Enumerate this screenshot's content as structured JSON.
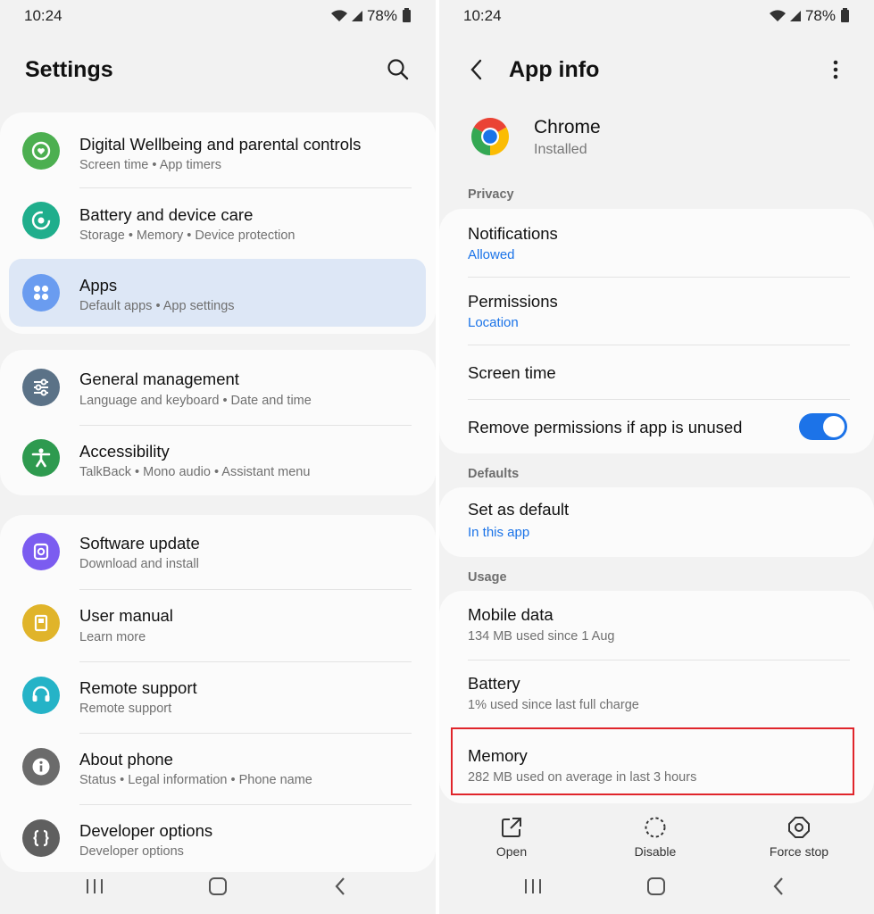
{
  "status_bar": {
    "time": "10:24",
    "battery": "78%"
  },
  "settings": {
    "title": "Settings",
    "groups": [
      {
        "items": [
          {
            "title": "Digital Wellbeing and parental controls",
            "subtitle": "Screen time  •  App timers",
            "icon": "digital-wellbeing-icon",
            "color": "#4caf50"
          },
          {
            "title": "Battery and device care",
            "subtitle": "Storage  •  Memory  •  Device protection",
            "icon": "device-care-icon",
            "color": "#1fae8c"
          },
          {
            "title": "Apps",
            "subtitle": "Default apps  •  App settings",
            "icon": "apps-icon",
            "color": "#6a9cf0"
          }
        ]
      },
      {
        "items": [
          {
            "title": "General management",
            "subtitle": "Language and keyboard  •  Date and time",
            "icon": "sliders-icon",
            "color": "#5b7287"
          },
          {
            "title": "Accessibility",
            "subtitle": "TalkBack  •  Mono audio  •  Assistant menu",
            "icon": "accessibility-icon",
            "color": "#2e9a4f"
          }
        ]
      },
      {
        "items": [
          {
            "title": "Software update",
            "subtitle": "Download and install",
            "icon": "software-update-icon",
            "color": "#7b5cf0"
          },
          {
            "title": "User manual",
            "subtitle": "Learn more",
            "icon": "manual-icon",
            "color": "#e0b42a"
          },
          {
            "title": "Remote support",
            "subtitle": "Remote support",
            "icon": "headset-icon",
            "color": "#25b3c7"
          },
          {
            "title": "About phone",
            "subtitle": "Status  •  Legal information  •  Phone name",
            "icon": "info-icon",
            "color": "#6b6b6b"
          },
          {
            "title": "Developer options",
            "subtitle": "Developer options",
            "icon": "braces-icon",
            "color": "#5f5f5f"
          }
        ]
      }
    ]
  },
  "app_info": {
    "title": "App info",
    "app_name": "Chrome",
    "app_status": "Installed",
    "sections": {
      "privacy": "Privacy",
      "defaults": "Defaults",
      "usage": "Usage"
    },
    "notifications": {
      "title": "Notifications",
      "value": "Allowed"
    },
    "permissions": {
      "title": "Permissions",
      "value": "Location"
    },
    "screen_time": {
      "title": "Screen time"
    },
    "remove_permissions": {
      "title": "Remove permissions if app is unused",
      "enabled": true
    },
    "set_default": {
      "title": "Set as default",
      "value": "In this app"
    },
    "mobile_data": {
      "title": "Mobile data",
      "value": "134 MB used since 1 Aug"
    },
    "battery": {
      "title": "Battery",
      "value": "1% used since last full charge"
    },
    "memory": {
      "title": "Memory",
      "value": "282 MB used on average in last 3 hours"
    },
    "actions": {
      "open": "Open",
      "disable": "Disable",
      "force_stop": "Force stop"
    }
  },
  "colors": {
    "accent": "#1a73e8",
    "highlight": "#dde7f6",
    "annotation": "#e0252b",
    "toggle": "#1c73e8"
  }
}
